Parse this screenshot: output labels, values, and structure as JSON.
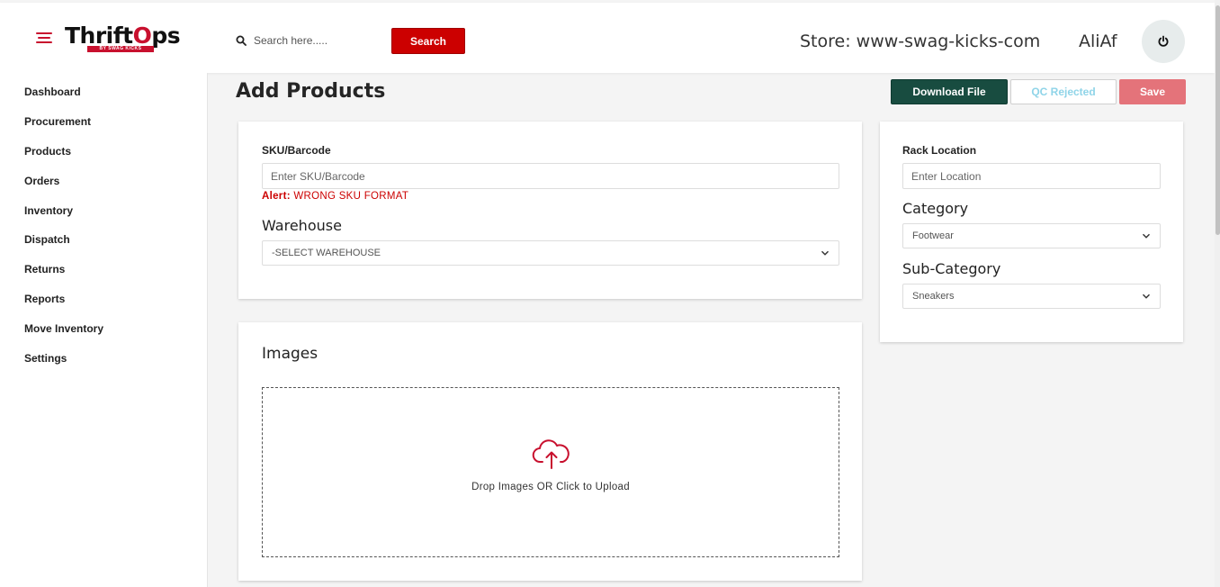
{
  "brand": {
    "logo": "ThriftOps",
    "logo_sub": "BY SWAG KICKS"
  },
  "topbar": {
    "search_placeholder": "Search here.....",
    "search_button": "Search",
    "store": "Store: www-swag-kicks-com",
    "user": "AliAf"
  },
  "sidebar": {
    "items": [
      {
        "label": "Dashboard"
      },
      {
        "label": "Procurement"
      },
      {
        "label": "Products"
      },
      {
        "label": "Orders"
      },
      {
        "label": "Inventory"
      },
      {
        "label": "Dispatch"
      },
      {
        "label": "Returns"
      },
      {
        "label": "Reports"
      },
      {
        "label": "Move Inventory"
      },
      {
        "label": "Settings"
      }
    ]
  },
  "page": {
    "title": "Add Products",
    "actions": {
      "download": "Download File",
      "qc_rejected": "QC Rejected",
      "save": "Save"
    }
  },
  "form": {
    "sku_label": "SKU/Barcode",
    "sku_placeholder": "Enter SKU/Barcode",
    "alert_prefix": "Alert:",
    "alert_message": "WRONG SKU FORMAT",
    "warehouse_label": "Warehouse",
    "warehouse_value": "-SELECT WAREHOUSE",
    "images_label": "Images",
    "dropzone_text": "Drop Images OR Click to Upload",
    "rack_label": "Rack Location",
    "rack_placeholder": "Enter Location",
    "category_label": "Category",
    "category_value": "Footwear",
    "subcategory_label": "Sub-Category",
    "subcategory_value": "Sneakers"
  },
  "colors": {
    "accent_red": "#cc0000",
    "download_green": "#184c40",
    "save_pink": "#e4737a",
    "qc_text": "#8fd4e8"
  },
  "icons": [
    "menu-icon",
    "search-icon",
    "power-icon",
    "chevron-down-icon",
    "cloud-upload-icon"
  ]
}
